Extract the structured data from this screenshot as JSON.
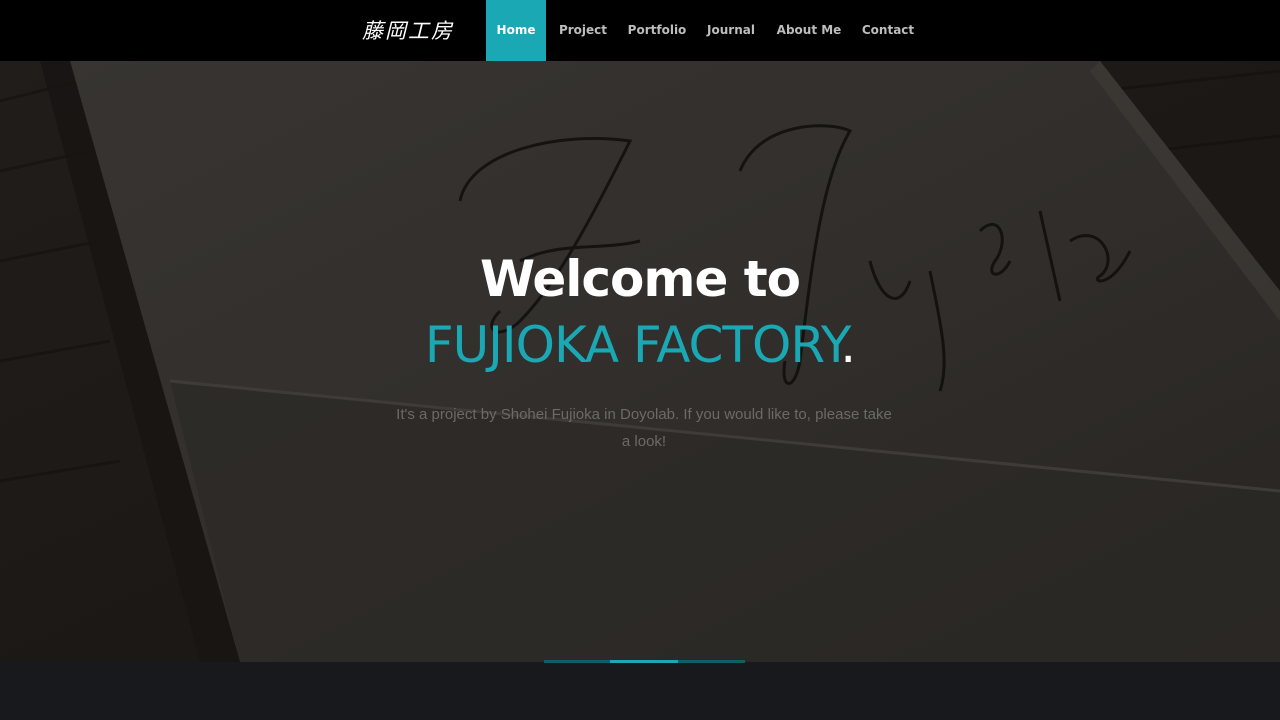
{
  "logo": {
    "text": "藤岡工房"
  },
  "nav": {
    "items": [
      {
        "label": "Home",
        "active": true
      },
      {
        "label": "Project",
        "active": false
      },
      {
        "label": "Portfolio",
        "active": false
      },
      {
        "label": "Journal",
        "active": false
      },
      {
        "label": "About Me",
        "active": false
      },
      {
        "label": "Contact",
        "active": false
      }
    ]
  },
  "hero": {
    "background_image": "carved-nameplate-photo",
    "headline": "Welcome to",
    "brand": "FUJIOKA FACTORY",
    "brand_suffix": ".",
    "subtitle": "It's a project by Shohei Fujioka in Doyolab. If you would like to, please take a look!"
  },
  "slider": {
    "slides": 3,
    "active_index": 1
  },
  "colors": {
    "accent": "#1aa8b4",
    "nav_bg": "#000000",
    "footer_bg": "#17191c"
  }
}
